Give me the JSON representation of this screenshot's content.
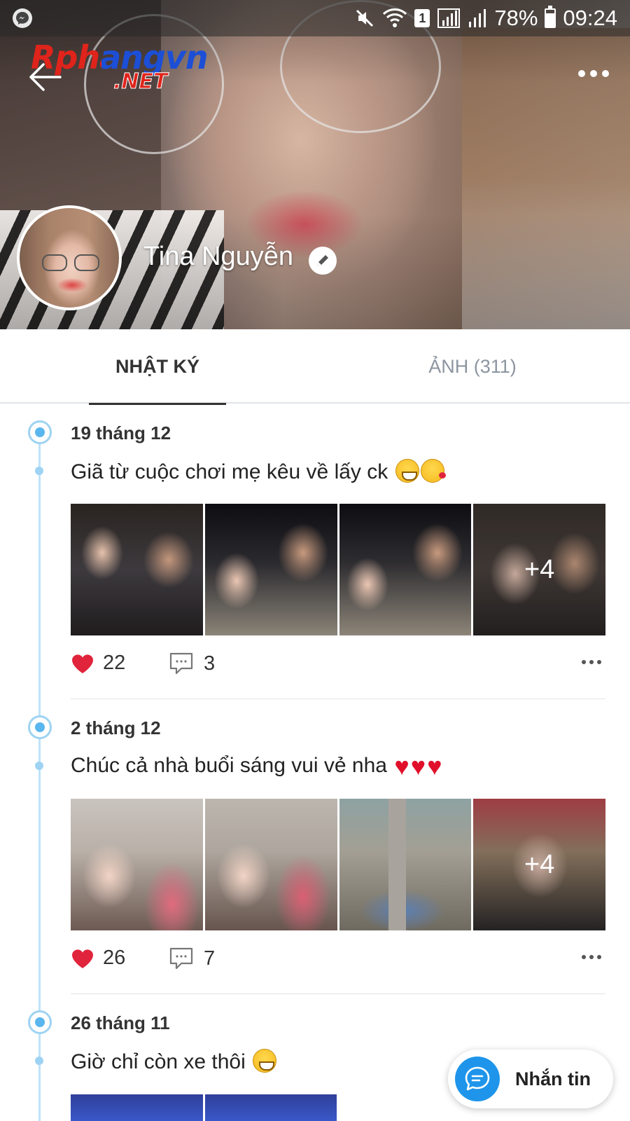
{
  "status_bar": {
    "battery": "78%",
    "time": "09:24",
    "sim_slot": "1",
    "battery_level": 0.78
  },
  "header": {
    "logo_line1": "Rphangvn",
    "logo_line2": ".NET"
  },
  "profile": {
    "name": "Tina Nguyễn"
  },
  "tabs": [
    {
      "label": "NHẬT KÝ",
      "active": true
    },
    {
      "label": "ẢNH (311)",
      "active": false
    }
  ],
  "posts": [
    {
      "date": "19 tháng 12",
      "text": "Giã từ cuộc chơi mẹ kêu về lấy ck",
      "emojis": [
        "grin",
        "kiss"
      ],
      "extra_photos": "+4",
      "likes": "22",
      "comments": "3"
    },
    {
      "date": "2 tháng 12",
      "text": "Chúc cả nhà buổi sáng vui vẻ nha",
      "emojis": [
        "heart",
        "heart",
        "heart"
      ],
      "extra_photos": "+4",
      "likes": "26",
      "comments": "7"
    },
    {
      "date": "26 tháng 11",
      "text": "Giờ chỉ còn xe thôi",
      "emojis": [
        "grin"
      ]
    }
  ],
  "message_button": {
    "label": "Nhắn tin"
  },
  "colors": {
    "accent": "#1e95ea",
    "timeline": "#9ed3f3",
    "like": "#e0243b"
  }
}
